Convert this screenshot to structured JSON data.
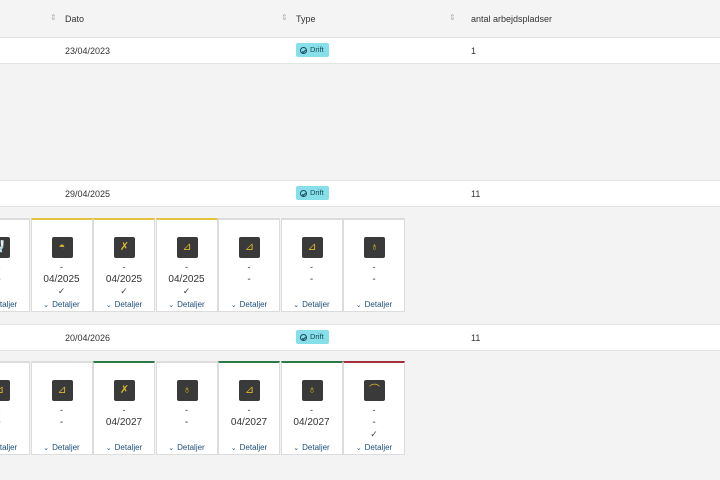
{
  "header": {
    "col_date": "Dato",
    "col_type": "Type",
    "col_workplaces": "antal arbejdspladser",
    "sort_icon": "⇕"
  },
  "rows": [
    {
      "date": "23/04/2023",
      "type": "Drift",
      "workplaces": "1"
    },
    {
      "date": "29/04/2025",
      "type": "Drift",
      "workplaces": "11"
    },
    {
      "date": "20/04/2026",
      "type": "Drift",
      "workplaces": "11"
    }
  ],
  "details_label": "Detaljer",
  "groups": [
    {
      "cards": [
        {
          "icon": "toilet-icon",
          "glyph": "🚽",
          "accent": "none",
          "line1": "-",
          "value": "-",
          "check": "",
          "border": "none"
        },
        {
          "icon": "sink-icon",
          "glyph": "◓",
          "accent": "yellow",
          "line1": "-",
          "value": "04/2025",
          "check": "✓",
          "border": "yellow"
        },
        {
          "icon": "tools-icon",
          "glyph": "✗",
          "accent": "yellow",
          "line1": "-",
          "value": "04/2025",
          "check": "✓",
          "border": "yellow"
        },
        {
          "icon": "toilet-icon",
          "glyph": "⊿",
          "accent": "yellow",
          "line1": "-",
          "value": "04/2025",
          "check": "✓",
          "border": "yellow"
        },
        {
          "icon": "toilet-icon",
          "glyph": "⊿",
          "accent": "none",
          "line1": "-",
          "value": "-",
          "check": "",
          "border": "none"
        },
        {
          "icon": "toilet-icon",
          "glyph": "⊿",
          "accent": "none",
          "line1": "-",
          "value": "-",
          "check": "",
          "border": "none"
        },
        {
          "icon": "basin-icon",
          "glyph": "♁",
          "accent": "none",
          "line1": "-",
          "value": "-",
          "check": "",
          "border": "none"
        }
      ]
    },
    {
      "cards": [
        {
          "icon": "toilet-icon",
          "glyph": "⊿",
          "accent": "none",
          "line1": "-",
          "value": "-",
          "check": "",
          "border": "none"
        },
        {
          "icon": "toilet-icon",
          "glyph": "⊿",
          "accent": "none",
          "line1": "-",
          "value": "-",
          "check": "",
          "border": "none"
        },
        {
          "icon": "tools-icon",
          "glyph": "✗",
          "accent": "green",
          "line1": "-",
          "value": "04/2027",
          "check": "",
          "border": "green"
        },
        {
          "icon": "basin-icon",
          "glyph": "♁",
          "accent": "none",
          "line1": "-",
          "value": "-",
          "check": "",
          "border": "none"
        },
        {
          "icon": "toilet-icon",
          "glyph": "⊿",
          "accent": "green",
          "line1": "-",
          "value": "04/2027",
          "check": "",
          "border": "green"
        },
        {
          "icon": "basin-icon",
          "glyph": "♁",
          "accent": "green",
          "line1": "-",
          "value": "04/2027",
          "check": "",
          "border": "green"
        },
        {
          "icon": "urinal-icon",
          "glyph": "⌒",
          "accent": "red",
          "line1": "-",
          "value": "-",
          "check": "✓",
          "border": "red"
        }
      ]
    }
  ]
}
